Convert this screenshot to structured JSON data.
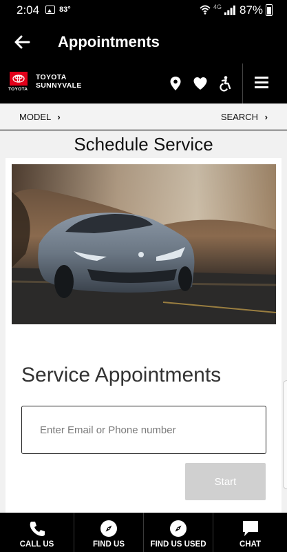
{
  "status_bar": {
    "time": "2:04",
    "temperature": "83°",
    "network": "4G",
    "battery_percent": "87%"
  },
  "app_bar": {
    "title": "Appointments",
    "back_icon": "arrow-left-icon"
  },
  "dealer": {
    "logo_text": "TOYOTA",
    "name_line1": "TOYOTA",
    "name_line2": "SUNNYVALE",
    "icons": [
      "location-pin-icon",
      "heart-icon",
      "accessibility-icon",
      "hamburger-menu-icon"
    ],
    "brand_color": "#e2001a"
  },
  "nav": {
    "model_label": "MODEL",
    "search_label": "SEARCH",
    "chevron": "›"
  },
  "main": {
    "page_title": "Schedule Service",
    "card_title": "Service Appointments",
    "input_placeholder": "Enter Email or Phone number",
    "input_value": "",
    "start_label": "Start",
    "start_disabled_color": "#d0d0d0"
  },
  "bottom_nav": {
    "items": [
      {
        "label": "CALL US",
        "icon": "phone-icon"
      },
      {
        "label": "FIND US",
        "icon": "compass-icon"
      },
      {
        "label": "FIND US USED",
        "icon": "compass-icon"
      },
      {
        "label": "CHAT",
        "icon": "chat-bubble-icon"
      }
    ]
  }
}
